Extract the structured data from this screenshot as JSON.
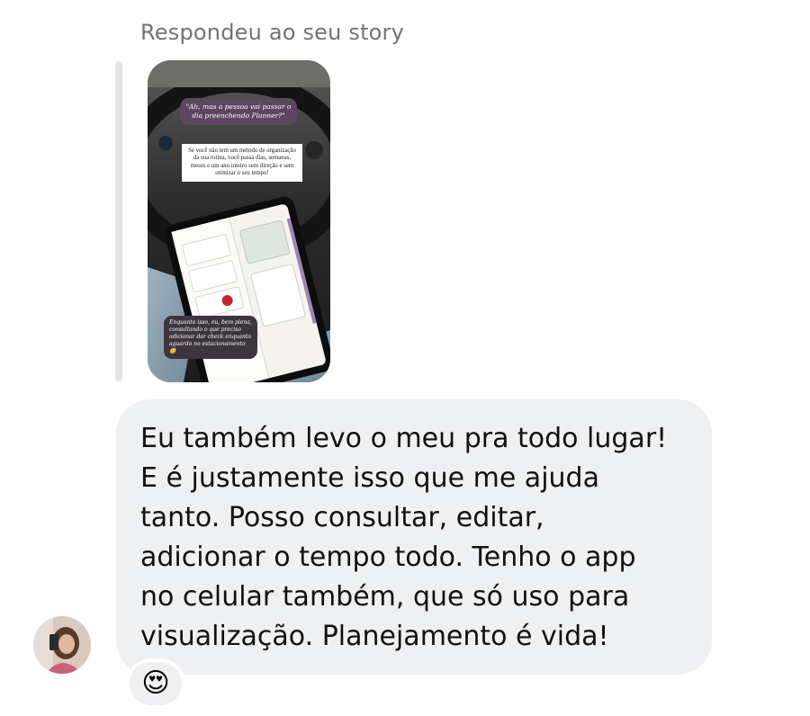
{
  "reply": {
    "label": "Respondeu ao seu story"
  },
  "story": {
    "quote": "\"Ah, mas a pessoa vai passar o dia preenchendo Planner?\"",
    "caption": "Se você não tem um método de organização da sua rotina, você passa dias, semanas, meses e um ano inteiro sem direção e sem otimizar o seu tempo!",
    "note": "Enquanto isso, eu, bem plena, consultando o que preciso adicionar dar check enquanto aguardo no estacionamento 😊"
  },
  "message": {
    "lines": [
      "Eu também levo o meu pra todo lugar!",
      "E é justamente isso que me ajuda",
      "tanto. Posso consultar, editar,",
      "adicionar o tempo todo. Tenho o app",
      "no celular também, que só uso para",
      "visualização. Planejamento é vida!"
    ]
  },
  "reaction": {
    "emoji": "😍"
  },
  "colors": {
    "bubble": "#eff0f2",
    "label": "#737373",
    "story_bar": "#e4e4e6"
  }
}
